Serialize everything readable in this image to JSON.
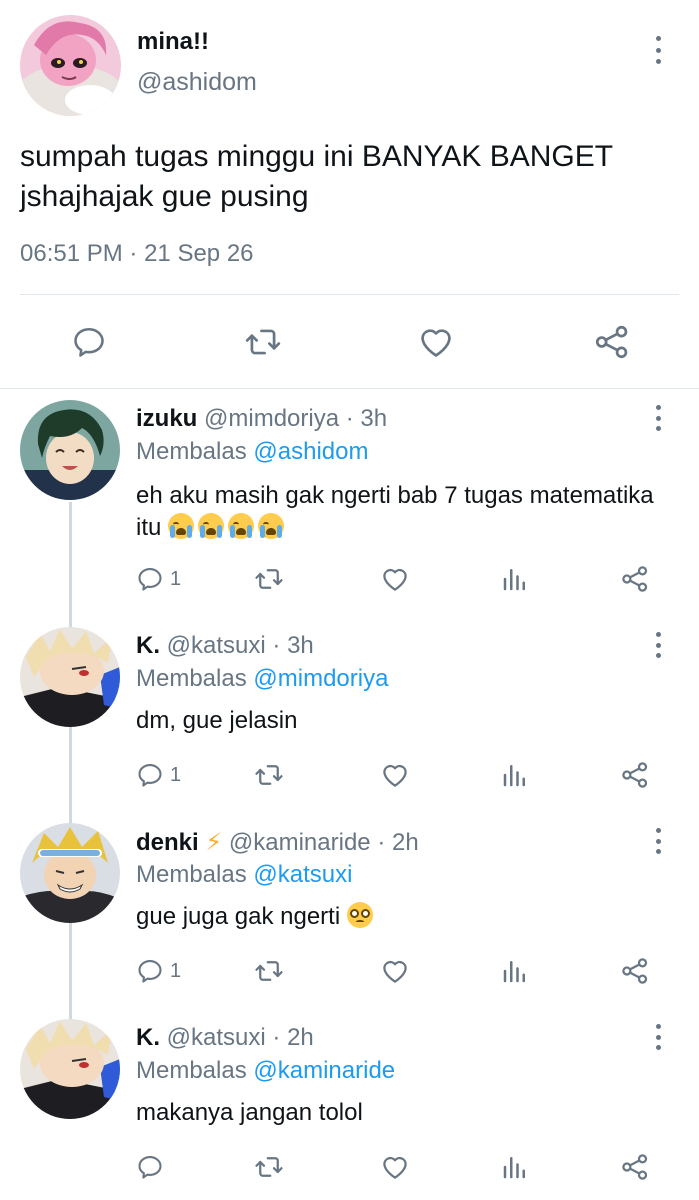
{
  "main_tweet": {
    "name": "mina!!",
    "handle": "@ashidom",
    "text": "sumpah tugas minggu ini BANYAK BANGET jshajhajak gue pusing",
    "time": "06:51 PM",
    "separator": "·",
    "date": "21 Sep 26",
    "actions": [
      "reply-icon",
      "retweet-icon",
      "like-icon",
      "share-icon"
    ]
  },
  "replies": [
    {
      "name": "izuku",
      "handle": "@mimdoriya",
      "time": "3h",
      "reply_label": "Membalas",
      "reply_to": "@ashidom",
      "text": "eh aku masih gak ngerti bab 7 tugas matematika itu",
      "emoji": "😭😭😭😭",
      "reply_count": "1"
    },
    {
      "name": "K.",
      "handle": "@katsuxi",
      "time": "3h",
      "reply_label": "Membalas",
      "reply_to": "@mimdoriya",
      "text": "dm, gue jelasin",
      "reply_count": "1"
    },
    {
      "name": "denki",
      "name_emoji": "⚡",
      "handle": "@kaminaride",
      "time": "2h",
      "reply_label": "Membalas",
      "reply_to": "@katsuxi",
      "text": "gue juga gak ngerti",
      "emoji": "🥺",
      "reply_count": "1"
    },
    {
      "name": "K.",
      "handle": "@katsuxi",
      "time": "2h",
      "reply_label": "Membalas",
      "reply_to": "@kaminaride",
      "text": "makanya jangan tolol",
      "reply_count": ""
    }
  ],
  "colors": {
    "accent": "#1d9bf0",
    "secondary_text": "#687684",
    "divider": "#e1e8ed"
  }
}
